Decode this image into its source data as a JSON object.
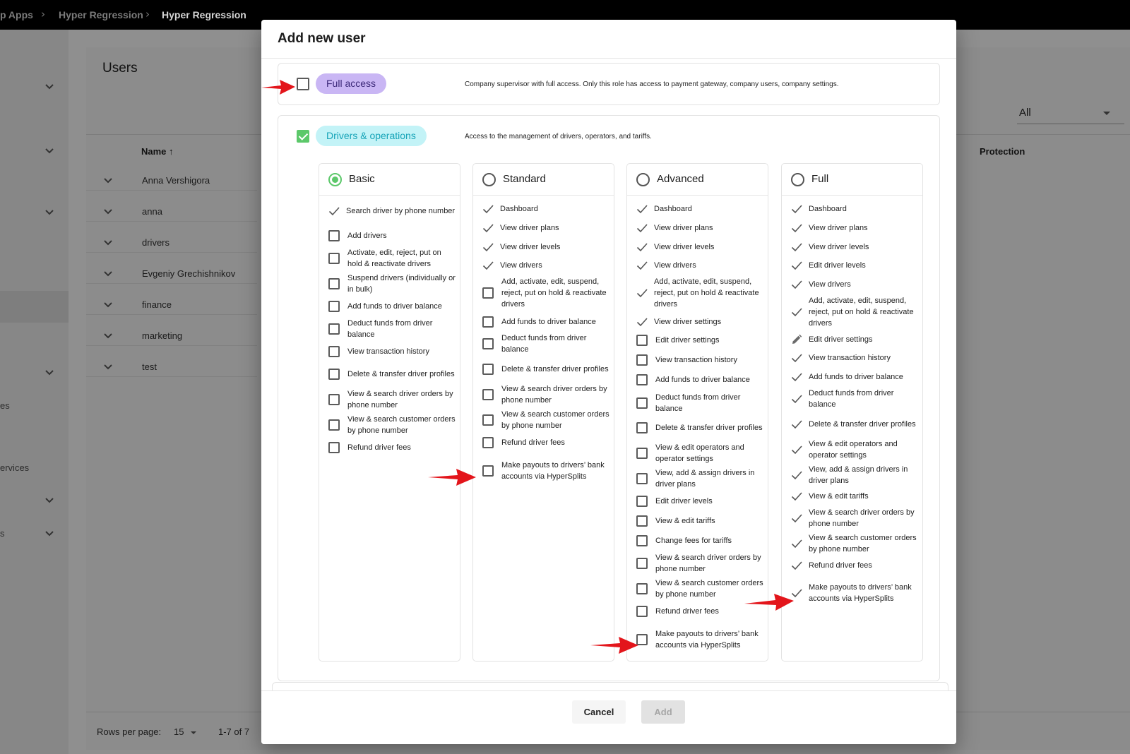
{
  "breadcrumbs": [
    "p Apps",
    "Hyper Regression",
    "Hyper Regression"
  ],
  "nav_fragments": [
    "es",
    "ervices",
    "s"
  ],
  "users_page": {
    "title": "Users",
    "filter_value": "All",
    "columns": {
      "name": "Name",
      "protection": "Protection"
    },
    "sort_indicator": "↑",
    "rows": [
      "Anna Vershigora",
      "anna",
      "drivers",
      "Evgeniy Grechishnikov",
      "finance",
      "marketing",
      "test"
    ],
    "rows_per_page_label": "Rows per page:",
    "rows_per_page_value": "15",
    "range_text": "1-7 of 7"
  },
  "modal": {
    "title": "Add new user",
    "full_access": {
      "label": "Full access",
      "checked": false,
      "description": "Company supervisor with full access. Only this role has access to payment gateway, company users, company settings."
    },
    "drivers_ops": {
      "label": "Drivers & operations",
      "checked": true,
      "description": "Access to the management of drivers, operators, and tariffs."
    },
    "levels": [
      {
        "name": "Basic",
        "selected": true,
        "items": [
          {
            "label": "Search driver by phone number",
            "state": "check"
          },
          {
            "label": "Add drivers",
            "state": "box"
          },
          {
            "label": "Activate, edit, reject, put on hold & reactivate drivers",
            "state": "box"
          },
          {
            "label": "Suspend drivers (individually or in bulk)",
            "state": "box"
          },
          {
            "label": "Add funds to driver balance",
            "state": "box"
          },
          {
            "label": "Deduct funds from driver balance",
            "state": "box"
          },
          {
            "label": "View transaction history",
            "state": "box"
          },
          {
            "label": "Delete & transfer driver profiles",
            "state": "box"
          },
          {
            "label": "View & search driver orders by phone number",
            "state": "box"
          },
          {
            "label": "View & search customer orders by phone number",
            "state": "box"
          },
          {
            "label": "Refund driver fees",
            "state": "box"
          }
        ]
      },
      {
        "name": "Standard",
        "selected": false,
        "items": [
          {
            "label": "Dashboard",
            "state": "check"
          },
          {
            "label": "View driver plans",
            "state": "check"
          },
          {
            "label": "View driver levels",
            "state": "check"
          },
          {
            "label": "View drivers",
            "state": "check"
          },
          {
            "label": "Add, activate, edit, suspend, reject, put on hold & reactivate drivers",
            "state": "box"
          },
          {
            "label": "Add funds to driver balance",
            "state": "box"
          },
          {
            "label": "Deduct funds from driver balance",
            "state": "box"
          },
          {
            "label": "Delete & transfer driver profiles",
            "state": "box"
          },
          {
            "label": "View & search driver orders by phone number",
            "state": "box"
          },
          {
            "label": "View & search customer orders by phone number",
            "state": "box"
          },
          {
            "label": "Refund driver fees",
            "state": "box"
          },
          {
            "label": "Make payouts to drivers’ bank accounts via HyperSplits",
            "state": "box"
          }
        ]
      },
      {
        "name": "Advanced",
        "selected": false,
        "items": [
          {
            "label": "Dashboard",
            "state": "check"
          },
          {
            "label": "View driver plans",
            "state": "check"
          },
          {
            "label": "View driver levels",
            "state": "check"
          },
          {
            "label": "View drivers",
            "state": "check"
          },
          {
            "label": "Add, activate, edit, suspend, reject, put on hold & reactivate drivers",
            "state": "check"
          },
          {
            "label": "View driver settings",
            "state": "check"
          },
          {
            "label": "Edit driver settings",
            "state": "box"
          },
          {
            "label": "View transaction history",
            "state": "box"
          },
          {
            "label": "Add funds to driver balance",
            "state": "box"
          },
          {
            "label": "Deduct funds from driver balance",
            "state": "box"
          },
          {
            "label": "Delete & transfer driver profiles",
            "state": "box"
          },
          {
            "label": "View & edit operators and operator settings",
            "state": "box"
          },
          {
            "label": "View, add & assign drivers in driver plans",
            "state": "box"
          },
          {
            "label": "Edit driver levels",
            "state": "box"
          },
          {
            "label": "View & edit tariffs",
            "state": "box"
          },
          {
            "label": "Change fees for tariffs",
            "state": "box"
          },
          {
            "label": "View & search driver orders by phone number",
            "state": "box"
          },
          {
            "label": "View & search customer orders by phone number",
            "state": "box"
          },
          {
            "label": "Refund driver fees",
            "state": "box"
          },
          {
            "label": "Make payouts to drivers’ bank accounts via HyperSplits",
            "state": "box"
          }
        ]
      },
      {
        "name": "Full",
        "selected": false,
        "items": [
          {
            "label": "Dashboard",
            "state": "check"
          },
          {
            "label": "View driver plans",
            "state": "check"
          },
          {
            "label": "View driver levels",
            "state": "check"
          },
          {
            "label": "Edit driver levels",
            "state": "check"
          },
          {
            "label": "View drivers",
            "state": "check"
          },
          {
            "label": "Add, activate, edit, suspend, reject, put on hold & reactivate drivers",
            "state": "check"
          },
          {
            "label": "Edit driver settings",
            "state": "pencil"
          },
          {
            "label": "View transaction history",
            "state": "check"
          },
          {
            "label": "Add funds to driver balance",
            "state": "check"
          },
          {
            "label": "Deduct funds from driver balance",
            "state": "check"
          },
          {
            "label": "Delete & transfer driver profiles",
            "state": "check"
          },
          {
            "label": "View & edit operators and operator settings",
            "state": "check"
          },
          {
            "label": "View, add & assign drivers in driver plans",
            "state": "check"
          },
          {
            "label": "View & edit tariffs",
            "state": "check"
          },
          {
            "label": "View & search driver orders by phone number",
            "state": "check"
          },
          {
            "label": "View & search customer orders by phone number",
            "state": "check"
          },
          {
            "label": "Refund driver fees",
            "state": "check"
          },
          {
            "label": "Make payouts to drivers’ bank accounts via HyperSplits",
            "state": "check"
          }
        ]
      }
    ],
    "cancel_label": "Cancel",
    "add_label": "Add"
  },
  "colors": {
    "accent_green": "#5cc86a",
    "chip_purple": "#c9b6f4",
    "chip_cyan": "#c3f3f7",
    "annotation_red": "#e3151b"
  }
}
